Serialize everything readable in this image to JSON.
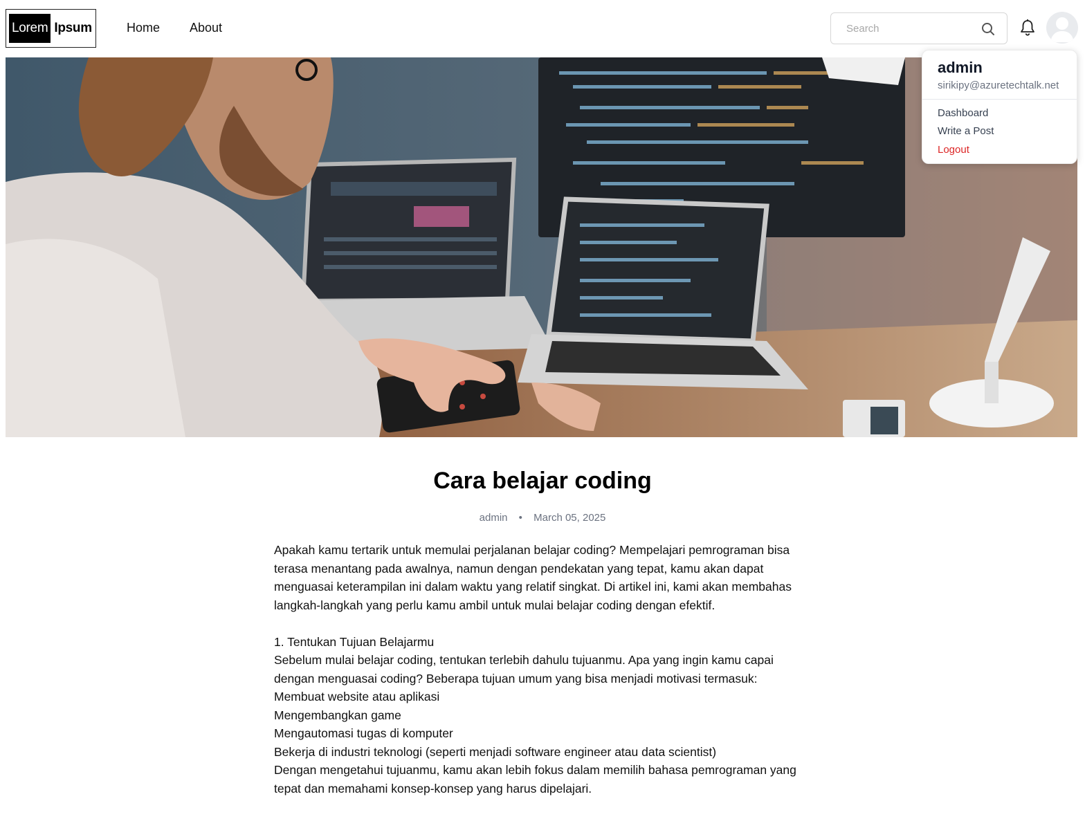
{
  "header": {
    "logo_dark": "Lorem",
    "logo_light": "Ipsum",
    "nav": [
      {
        "label": "Home"
      },
      {
        "label": "About"
      }
    ],
    "search_placeholder": "Search",
    "icons": [
      "search-icon",
      "bell-icon",
      "user-avatar-icon"
    ]
  },
  "user_menu": {
    "name": "admin",
    "email": "sirikipy@azuretechtalk.net",
    "items": [
      {
        "label": "Dashboard"
      },
      {
        "label": "Write a Post"
      },
      {
        "label": "Logout"
      }
    ],
    "logout_color": "#dc2626"
  },
  "post": {
    "title": "Cara belajar coding",
    "author": "admin",
    "separator": "•",
    "date": "March 05, 2025",
    "intro": "Apakah kamu tertarik untuk memulai perjalanan belajar coding? Mempelajari pemrograman bisa terasa menantang pada awalnya, namun dengan pendekatan yang tepat, kamu akan dapat menguasai keterampilan ini dalam waktu yang relatif singkat. Di artikel ini, kami akan membahas langkah-langkah yang perlu kamu ambil untuk mulai belajar coding dengan efektif.",
    "section_heading": "1. Tentukan Tujuan Belajarmu",
    "section_intro": "Sebelum mulai belajar coding, tentukan terlebih dahulu tujuanmu. Apa yang ingin kamu capai dengan menguasai coding? Beberapa tujuan umum yang bisa menjadi motivasi termasuk:",
    "goals": [
      "Membuat website atau aplikasi",
      "Mengembangkan game",
      "Mengautomasi tugas di komputer",
      "Bekerja di industri teknologi (seperti menjadi software engineer atau data scientist)"
    ],
    "section_outro": "Dengan mengetahui tujuanmu, kamu akan lebih fokus dalam memilih bahasa pemrograman yang tepat dan memahami konsep-konsep yang harus dipelajari."
  },
  "hero_image": {
    "subject": "programmer-at-desk-with-laptops-photo"
  }
}
